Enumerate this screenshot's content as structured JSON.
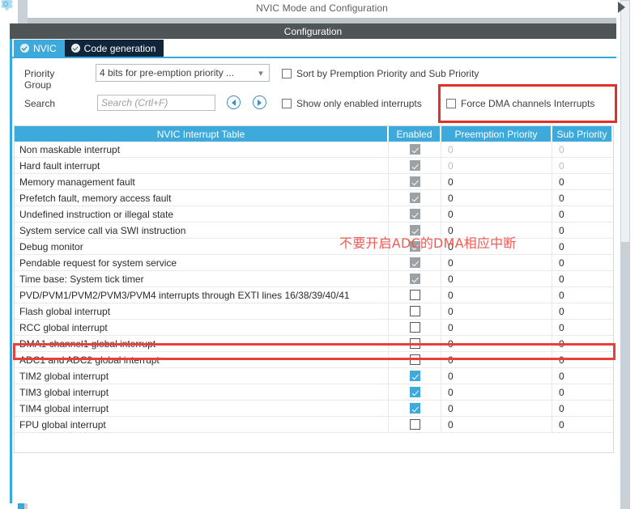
{
  "window": {
    "title": "NVIC Mode and Configuration",
    "section_bar": "Configuration",
    "scroll_arrow_icon": "triangle-right-icon",
    "corner_icon": "gear-icon"
  },
  "tabs": [
    {
      "label": "NVIC",
      "active": true,
      "status_icon": "check-circle-icon"
    },
    {
      "label": "Code generation",
      "active": false,
      "status_icon": "check-circle-icon"
    }
  ],
  "form": {
    "priority_group_label": "Priority Group",
    "priority_group_value": "4 bits for pre-emption priority ...",
    "priority_group_chevron": "chevron-down-icon",
    "search_label": "Search",
    "search_value": "",
    "search_placeholder": "Search (Crtl+F)",
    "prev_icon": "circle-arrow-left-icon",
    "next_icon": "circle-arrow-right-icon",
    "sort_checkbox_label": "Sort by Premption Priority and Sub Priority",
    "sort_checkbox_checked": false,
    "show_enabled_checkbox_label": "Show only enabled interrupts",
    "show_enabled_checkbox_checked": false,
    "force_dma_checkbox_label": "Force DMA channels Interrupts",
    "force_dma_checkbox_checked": false
  },
  "table": {
    "headers": {
      "name": "NVIC Interrupt Table",
      "enabled": "Enabled",
      "preemption": "Preemption Priority",
      "sub": "Sub Priority"
    },
    "rows": [
      {
        "name": "Non maskable interrupt",
        "enabled": "checked-disabled",
        "pre": "0",
        "sub": "0",
        "dim": true
      },
      {
        "name": "Hard fault interrupt",
        "enabled": "checked-disabled",
        "pre": "0",
        "sub": "0",
        "dim": true
      },
      {
        "name": "Memory management fault",
        "enabled": "checked-disabled",
        "pre": "0",
        "sub": "0",
        "dim": false
      },
      {
        "name": "Prefetch fault, memory access fault",
        "enabled": "checked-disabled",
        "pre": "0",
        "sub": "0",
        "dim": false
      },
      {
        "name": "Undefined instruction or illegal state",
        "enabled": "checked-disabled",
        "pre": "0",
        "sub": "0",
        "dim": false
      },
      {
        "name": "System service call via SWI instruction",
        "enabled": "checked-disabled",
        "pre": "0",
        "sub": "0",
        "dim": false
      },
      {
        "name": "Debug monitor",
        "enabled": "checked-disabled",
        "pre": "0",
        "sub": "0",
        "dim": false
      },
      {
        "name": "Pendable request for system service",
        "enabled": "checked-disabled",
        "pre": "0",
        "sub": "0",
        "dim": false
      },
      {
        "name": "Time base: System tick timer",
        "enabled": "checked-disabled",
        "pre": "0",
        "sub": "0",
        "dim": false
      },
      {
        "name": "PVD/PVM1/PVM2/PVM3/PVM4 interrupts through EXTI lines 16/38/39/40/41",
        "enabled": "empty",
        "pre": "0",
        "sub": "0",
        "dim": false
      },
      {
        "name": "Flash global interrupt",
        "enabled": "empty",
        "pre": "0",
        "sub": "0",
        "dim": false
      },
      {
        "name": "RCC global interrupt",
        "enabled": "empty",
        "pre": "0",
        "sub": "0",
        "dim": false
      },
      {
        "name": "DMA1 channel1 global interrupt",
        "enabled": "empty",
        "pre": "0",
        "sub": "0",
        "dim": false
      },
      {
        "name": "ADC1 and ADC2 global interrupt",
        "enabled": "empty",
        "pre": "0",
        "sub": "0",
        "dim": false
      },
      {
        "name": "TIM2 global interrupt",
        "enabled": "checked-active",
        "pre": "0",
        "sub": "0",
        "dim": false
      },
      {
        "name": "TIM3 global interrupt",
        "enabled": "checked-active",
        "pre": "0",
        "sub": "0",
        "dim": false
      },
      {
        "name": "TIM4 global interrupt",
        "enabled": "checked-active",
        "pre": "0",
        "sub": "0",
        "dim": false
      },
      {
        "name": "FPU global interrupt",
        "enabled": "empty",
        "pre": "0",
        "sub": "0",
        "dim": false
      }
    ]
  },
  "annotations": {
    "note_text": "不要开启ADC的DMA相应中断",
    "note_color": "#f05a52",
    "highlight_color": "#e03028"
  },
  "colors": {
    "accent_blue": "#3eaadc",
    "dark_bar": "#4f5457",
    "tab_dark": "#10243a"
  }
}
